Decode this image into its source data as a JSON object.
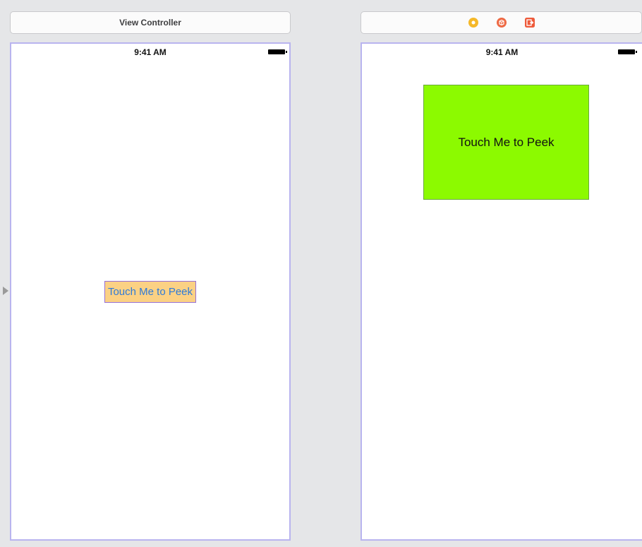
{
  "left_scene": {
    "header_title": "View Controller",
    "status_time": "9:41 AM",
    "button_label": "Touch Me to Peek"
  },
  "right_scene": {
    "header_icons": [
      "first-responder-icon",
      "cube-icon",
      "exit-icon"
    ],
    "status_time": "9:41 AM",
    "view_label": "Touch Me to Peek"
  },
  "colors": {
    "canvas_background": "#e5e6e8",
    "selection_border": "#b9b4ef",
    "button_background": "#fbd184",
    "button_text": "#2f7bd8",
    "green_view": "#8cfa00",
    "first_responder_icon": "#f5b829",
    "cube_icon": "#ee6a45",
    "exit_icon": "#ee5a3a"
  }
}
